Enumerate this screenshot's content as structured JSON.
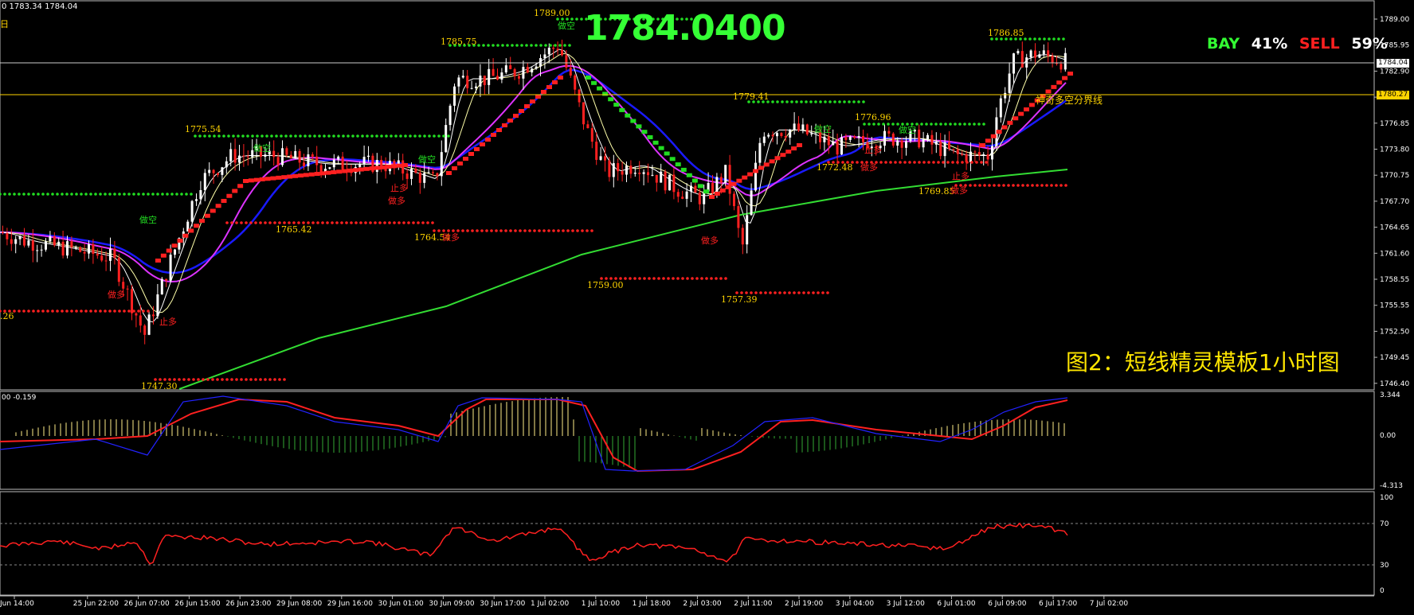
{
  "header": {
    "ohlc_text": "0 1783.34 1784.04",
    "sub_text": "日"
  },
  "big_price": "1784.0400",
  "bay_sell": {
    "bay_label": "BAY",
    "bay_pct": "41%",
    "sell_label": "SELL",
    "sell_pct": "59%"
  },
  "caption": "图2：短线精灵模板1小时图",
  "price_axis": {
    "ticks": [
      "1789.00",
      "1785.95",
      "1782.90",
      "1779.85",
      "1776.85",
      "1773.80",
      "1770.75",
      "1767.70",
      "1764.65",
      "1761.60",
      "1758.55",
      "1755.55",
      "1752.50",
      "1749.45",
      "1746.40"
    ],
    "current_price_tag": "1784.04",
    "line_tag": "1780.27"
  },
  "boundary_line_label": "神奇多空分界线",
  "price_labels": [
    "1789.00",
    "1785.75",
    "1775.54",
    "1765.42",
    "1764.54",
    "1759.00",
    "1779.41",
    "1776.96",
    "1772.48",
    "1757.39",
    "1769.85",
    "1786.85",
    "1747.30",
    ".26"
  ],
  "signal_labels": {
    "short": "做空",
    "long": "做多",
    "stop_long": "止多",
    "stop_short": "止空"
  },
  "macd": {
    "label": "00 -0.159",
    "ticks": [
      "3.344",
      "0.00",
      "-4.313"
    ]
  },
  "rsi": {
    "ticks": [
      "100",
      "70",
      "30",
      "0"
    ]
  },
  "time_axis": [
    "Jun 14:00",
    "25 Jun 22:00",
    "26 Jun 07:00",
    "26 Jun 15:00",
    "26 Jun 23:00",
    "29 Jun 08:00",
    "29 Jun 16:00",
    "30 Jun 01:00",
    "30 Jun 09:00",
    "30 Jun 17:00",
    "1 Jul 02:00",
    "1 Jul 10:00",
    "1 Jul 18:00",
    "2 Jul 03:00",
    "2 Jul 11:00",
    "2 Jul 19:00",
    "3 Jul 04:00",
    "3 Jul 12:00",
    "6 Jul 01:00",
    "6 Jul 09:00",
    "6 Jul 17:00",
    "7 Jul 02:00"
  ],
  "colors": {
    "background": "#000000",
    "bull": "#ffffff",
    "bear": "#ff2020",
    "up_dots": "#22dd22",
    "down_dots": "#ff2020",
    "ma_blue": "#1a1aff",
    "ma_magenta": "#dd33ff",
    "ma_green": "#33dd33",
    "label_yellow": "#ffd400",
    "bay_green": "#33ff33",
    "sell_red": "#ff2020"
  }
}
